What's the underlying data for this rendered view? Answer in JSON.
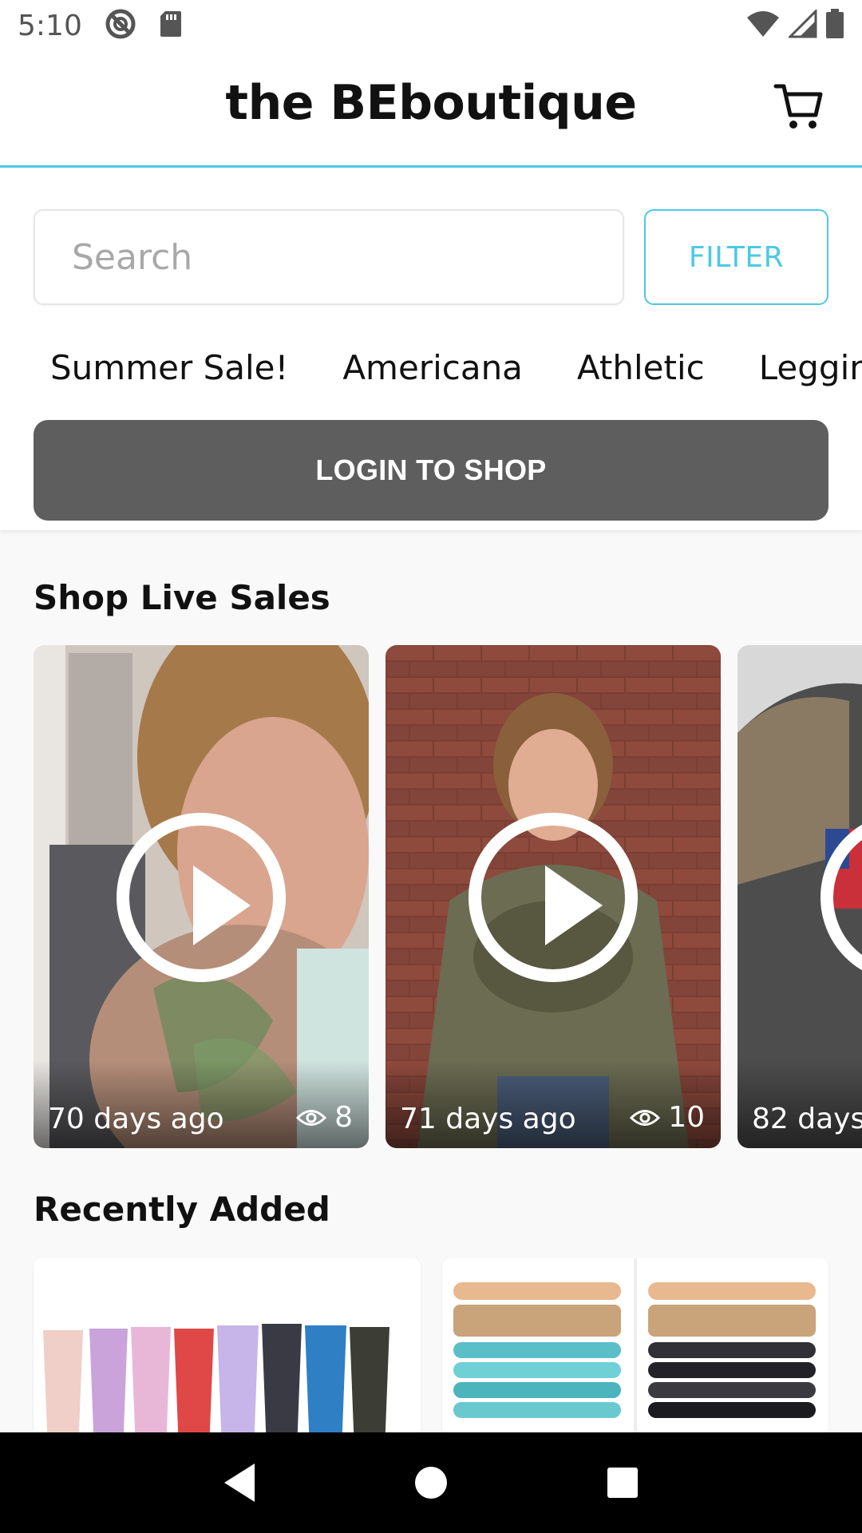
{
  "status_bar": {
    "time": "5:10",
    "icons_left": [
      "do-not-disturb-icon",
      "sd-card-icon"
    ],
    "icons_right": [
      "wifi-icon",
      "signal-icon",
      "battery-icon"
    ]
  },
  "header": {
    "title": "the BEboutique",
    "cart_icon": "cart-icon"
  },
  "search": {
    "placeholder": "Search",
    "value": ""
  },
  "filter_label": "FILTER",
  "categories": [
    "Summer Sale!",
    "Americana",
    "Athletic",
    "Leggings"
  ],
  "login_button": "LOGIN TO SHOP",
  "live_sales": {
    "title": "Shop Live Sales",
    "items": [
      {
        "days": "70 days ago",
        "views": "8"
      },
      {
        "days": "71 days ago",
        "views": "10"
      },
      {
        "days": "82 days",
        "views": ""
      }
    ]
  },
  "recently_added": {
    "title": "Recently Added"
  },
  "colors": {
    "accent": "#4cc9e6",
    "login_bg": "#5e5e5e",
    "background": "#f9f9f9"
  }
}
